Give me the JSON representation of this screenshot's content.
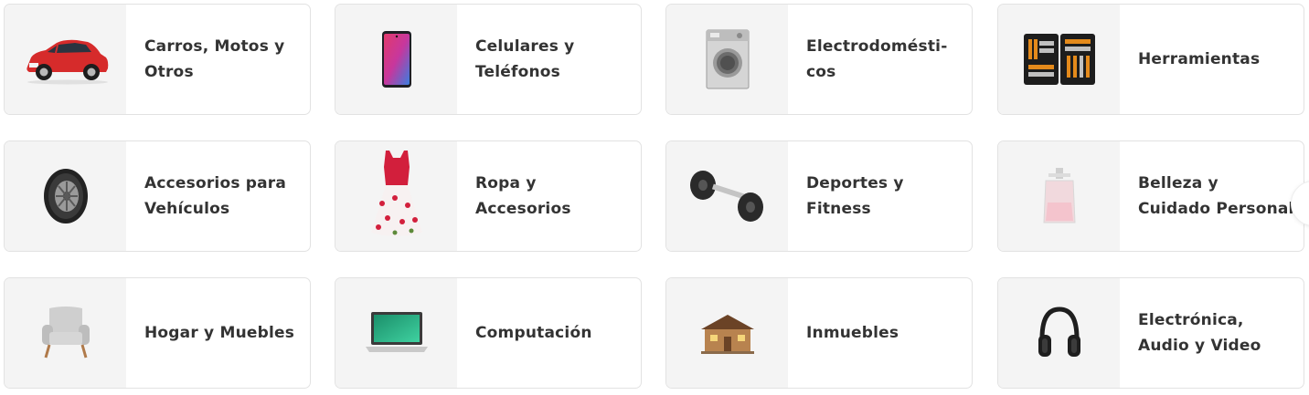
{
  "categories": [
    {
      "label": "Carros, Motos y Otros",
      "icon": "car-icon"
    },
    {
      "label": "Celulares y Teléfonos",
      "icon": "smartphone-icon"
    },
    {
      "label": "Electrodomésti-cos",
      "icon": "washing-machine-icon"
    },
    {
      "label": "Herramientas",
      "icon": "toolkit-icon"
    },
    {
      "label": "Accesorios para Vehículos",
      "icon": "tire-icon"
    },
    {
      "label": "Ropa y Accesorios",
      "icon": "dress-icon"
    },
    {
      "label": "Deportes y Fitness",
      "icon": "dumbbell-icon"
    },
    {
      "label": "Belleza y Cuidado Personal",
      "icon": "perfume-icon"
    },
    {
      "label": "Hogar y Muebles",
      "icon": "armchair-icon"
    },
    {
      "label": "Computación",
      "icon": "laptop-icon"
    },
    {
      "label": "Inmuebles",
      "icon": "house-icon"
    },
    {
      "label": "Electrónica, Audio y Video",
      "icon": "headphones-icon"
    }
  ],
  "colors": {
    "text": "#333333",
    "card_border": "#e2e2e2",
    "thumb_background": "#f4f4f4"
  }
}
